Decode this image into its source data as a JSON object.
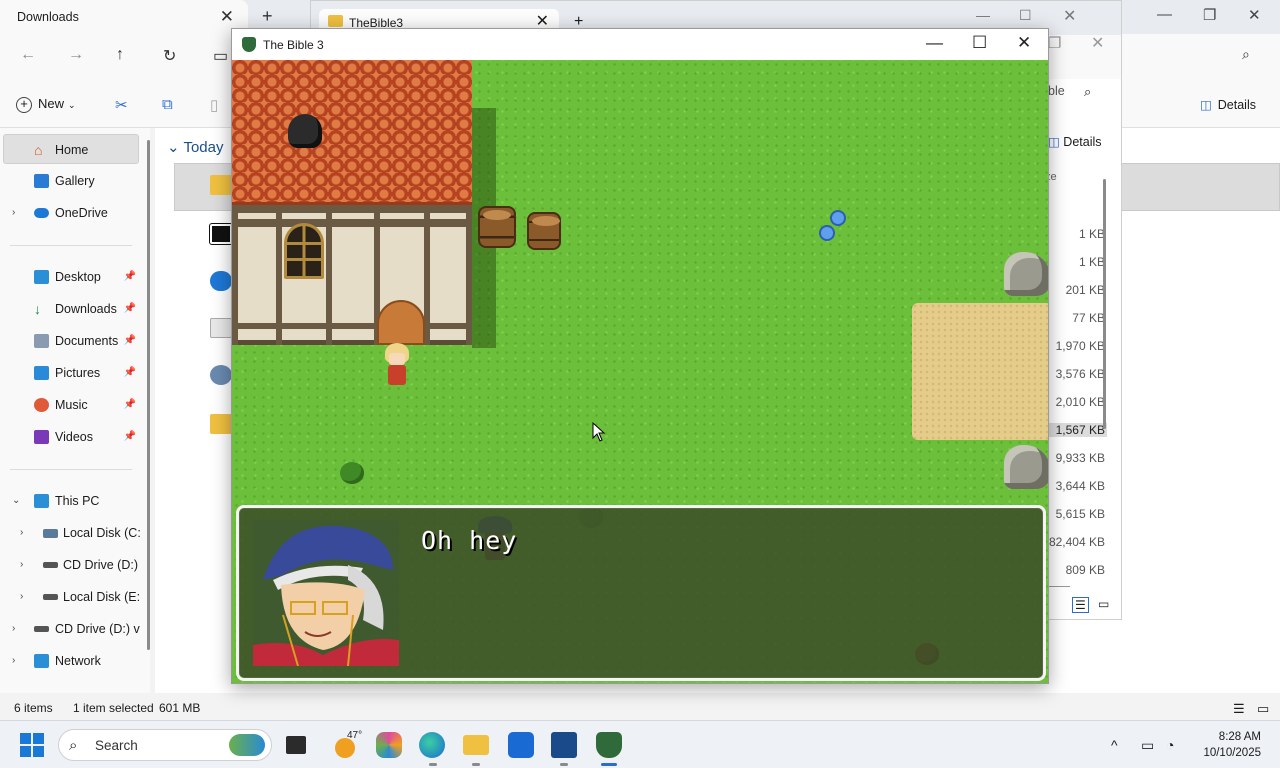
{
  "explorer": {
    "tab_title": "Downloads",
    "new_label": "New",
    "details_label": "Details",
    "today_label": "Today",
    "sidebar": {
      "home": "Home",
      "gallery": "Gallery",
      "onedrive": "OneDrive",
      "desktop": "Desktop",
      "downloads": "Downloads",
      "documents": "Documents",
      "pictures": "Pictures",
      "music": "Music",
      "videos": "Videos",
      "this_pc": "This PC",
      "local_c": "Local Disk (C:)",
      "cd_d": "CD Drive (D:) v",
      "local_e": "Local Disk (E:)",
      "cd_d2": "CD Drive (D:) vir",
      "network": "Network"
    },
    "status": {
      "items": "6 items",
      "selected": "1 item selected",
      "size": "601 MB"
    }
  },
  "explorer2": {
    "tab_title": "TheBible3",
    "search_tail": "ble",
    "details_label": "Details",
    "col_header": "ze",
    "sizes": [
      "1 KB",
      "1 KB",
      "201 KB",
      "77 KB",
      "1,970 KB",
      "3,576 KB",
      "2,010 KB",
      "1,567 KB",
      "9,933 KB",
      "3,644 KB",
      "5,615 KB",
      "82,404 KB",
      "809 KB"
    ],
    "highlight_index": 7
  },
  "game": {
    "window_title": "The Bible 3",
    "dialog_text": "Oh hey"
  },
  "taskbar": {
    "search_label": "Search",
    "weather_temp": "47°",
    "time": "8:28 AM",
    "date": "10/10/2025"
  }
}
